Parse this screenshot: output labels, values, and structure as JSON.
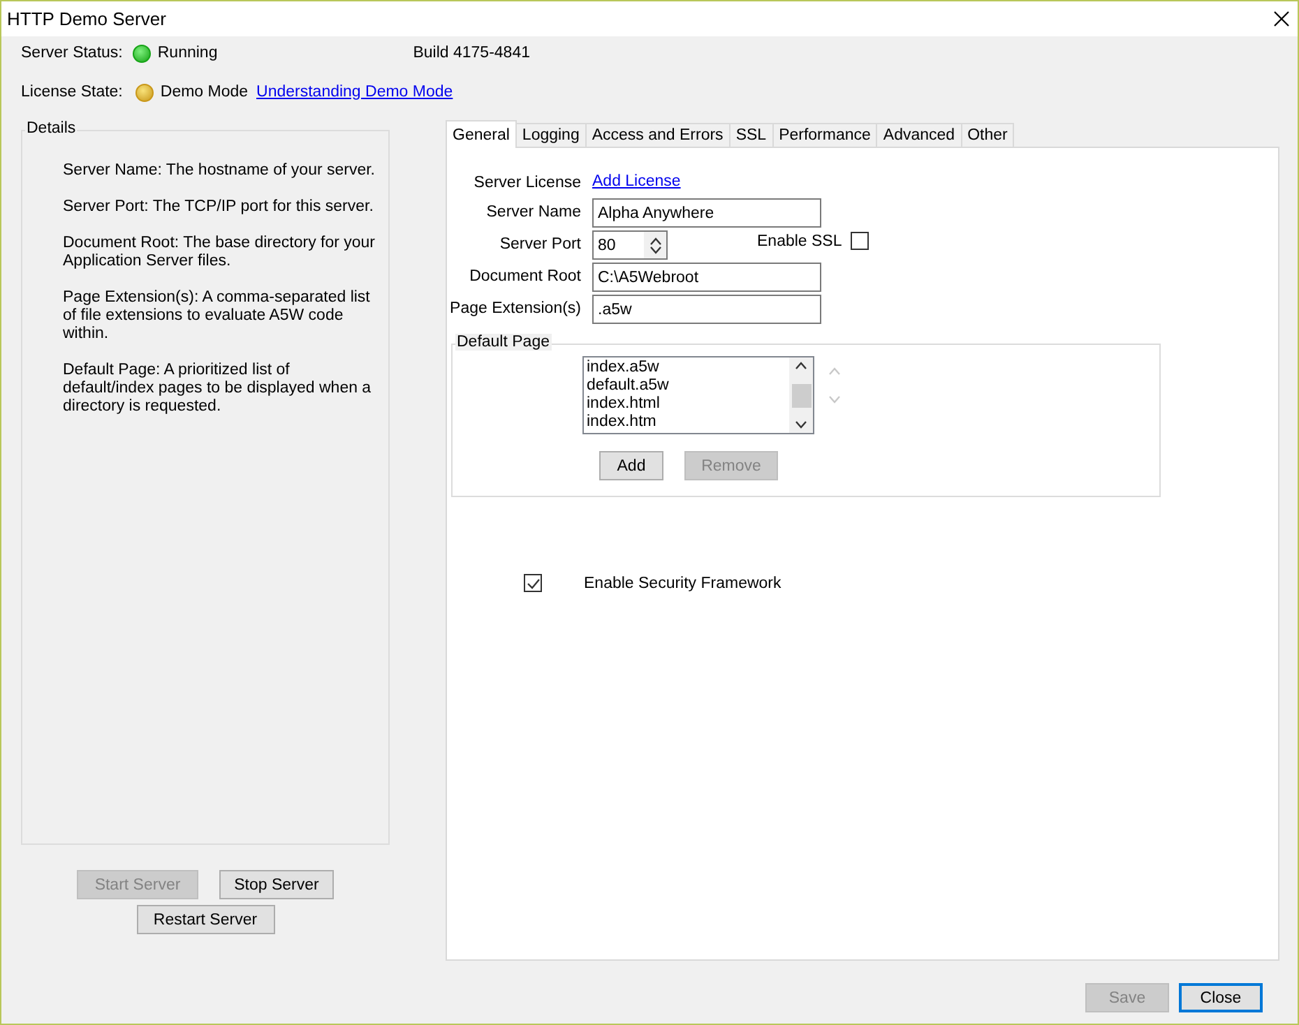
{
  "window": {
    "title": "HTTP Demo Server"
  },
  "status": {
    "server_label": "Server Status:",
    "server_state": "Running",
    "build": "Build 4175-4841",
    "license_label": "License State:",
    "license_state": "Demo Mode",
    "license_link": "Understanding Demo Mode"
  },
  "details": {
    "title": "Details",
    "paragraphs": [
      "Server Name: The hostname of your server.",
      "Server Port: The TCP/IP port for this server.",
      "Document Root: The base directory for your Application Server files.",
      "Page Extension(s): A comma-separated list of file extensions to evaluate A5W code within.",
      "Default Page: A prioritized list of default/index pages to be displayed when a directory is requested."
    ]
  },
  "server_buttons": [
    {
      "label": "Start Server",
      "disabled": true
    },
    {
      "label": "Stop Server",
      "disabled": false
    },
    {
      "label": "Restart Server",
      "disabled": false
    }
  ],
  "tabs": [
    {
      "label": "General",
      "selected": true
    },
    {
      "label": "Logging",
      "selected": false
    },
    {
      "label": "Access and Errors",
      "selected": false
    },
    {
      "label": "SSL",
      "selected": false
    },
    {
      "label": "Performance",
      "selected": false
    },
    {
      "label": "Advanced",
      "selected": false
    },
    {
      "label": "Other",
      "selected": false
    }
  ],
  "general": {
    "license_label": "Server License",
    "license_link": "Add License",
    "server_name_label": "Server Name",
    "server_name": "Alpha Anywhere",
    "port_label": "Server Port",
    "port": "80",
    "ssl_label": "Enable SSL",
    "ssl_checked": false,
    "doc_root_label": "Document Root",
    "doc_root": "C:\\A5Webroot",
    "ext_label": "Page Extension(s)",
    "ext": ".a5w",
    "default_page": {
      "title": "Default Page",
      "items": [
        "index.a5w",
        "default.a5w",
        "index.html",
        "index.htm"
      ],
      "add": {
        "label": "Add",
        "disabled": false
      },
      "remove": {
        "label": "Remove",
        "disabled": true
      }
    },
    "security_label": "Enable Security Framework",
    "security_checked": true
  },
  "footer": [
    {
      "label": "Save",
      "disabled": true,
      "default": false
    },
    {
      "label": "Close",
      "disabled": false,
      "default": true
    }
  ]
}
